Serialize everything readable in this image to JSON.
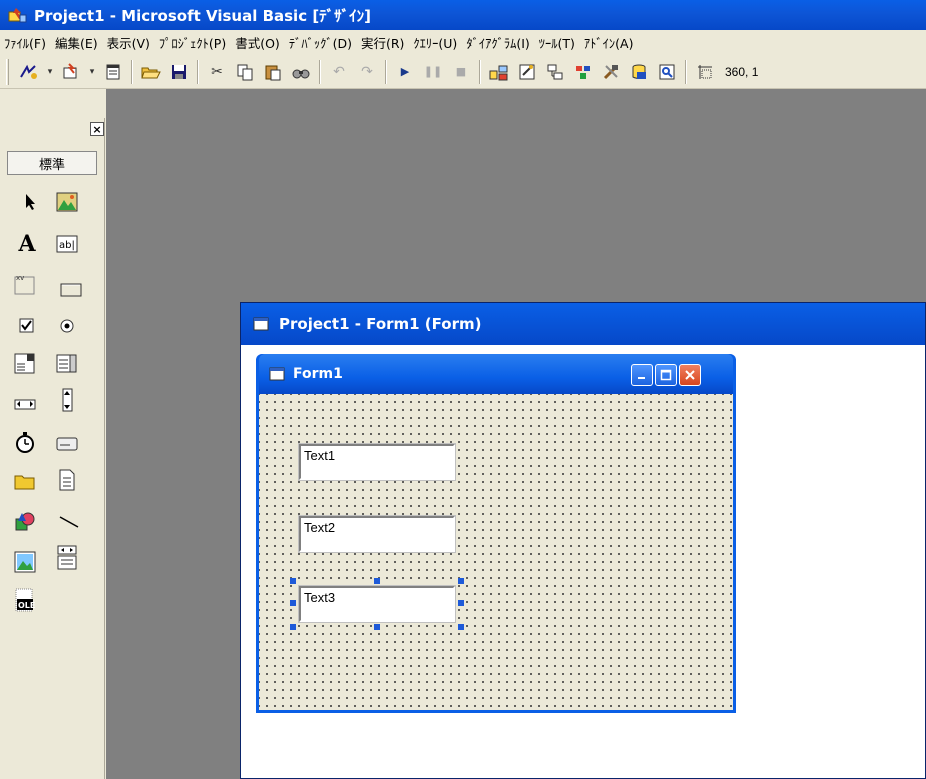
{
  "window": {
    "title": "Project1 - Microsoft Visual Basic [ﾃﾞｻﾞｲﾝ]"
  },
  "menu": {
    "items": [
      "ﾌｧｲﾙ(F)",
      "編集(E)",
      "表示(V)",
      "ﾌﾟﾛｼﾞｪｸﾄ(P)",
      "書式(O)",
      "ﾃﾞﾊﾞｯｸﾞ(D)",
      "実行(R)",
      "ｸｴﾘｰ(U)",
      "ﾀﾞｲｱｸﾞﾗﾑ(I)",
      "ﾂｰﾙ(T)",
      "ｱﾄﾞｲﾝ(A)"
    ]
  },
  "toolbar": {
    "coords": "360, 1"
  },
  "toolbox": {
    "tab_label": "標準",
    "close_glyph": "×",
    "tools": [
      "pointer",
      "picture-box",
      "label",
      "text-box",
      "frame",
      "command-button",
      "check-box",
      "option-button",
      "combo-box",
      "list-box",
      "hscroll",
      "vscroll",
      "timer",
      "drive-list",
      "dir-list",
      "file-list",
      "shape",
      "line",
      "image",
      "data",
      "ole"
    ]
  },
  "project_window": {
    "title": "Project1 - Form1 (Form)"
  },
  "form": {
    "title": "Form1",
    "textboxes": [
      {
        "text": "Text1"
      },
      {
        "text": "Text2"
      },
      {
        "text": "Text3",
        "selected": true
      }
    ]
  },
  "colors": {
    "title_blue": "#0a5fe6",
    "workspace_gray": "#808080",
    "face": "#ece9d8",
    "handle_blue": "#1e5ad8"
  }
}
